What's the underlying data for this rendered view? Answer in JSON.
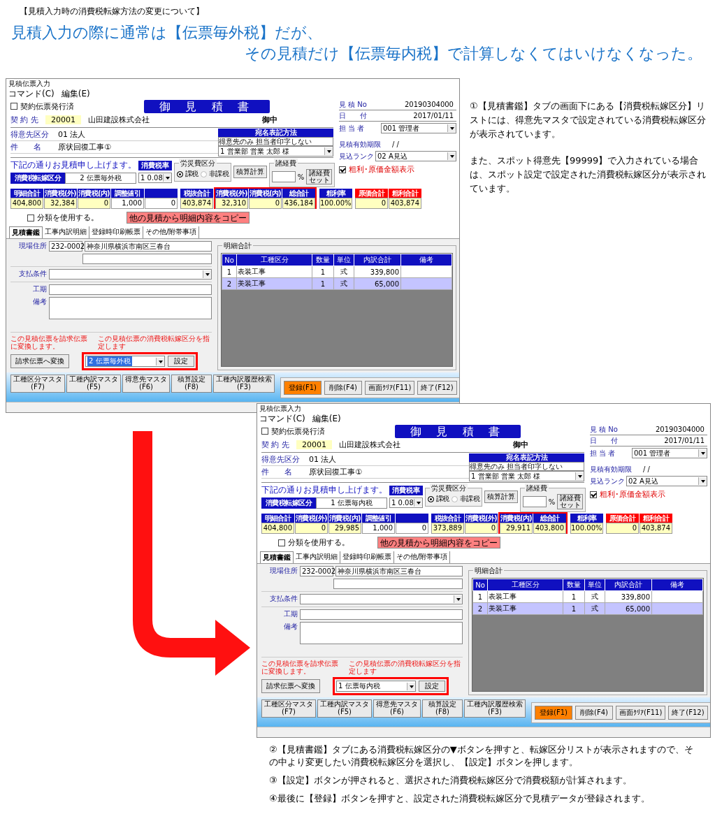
{
  "page_heading": "【見積入力時の消費税転嫁方法の変更について】",
  "headline": [
    "見積入力の際に通常は【伝票毎外税】だが、",
    "その見積だけ【伝票毎内税】で計算しなくてはいけなくなった。"
  ],
  "side_notes": [
    "①【見積書鑑】タブの画面下にある【消費税転嫁区分】リストには、得意先マスタで設定されている消費税転嫁区分が表示されています。",
    "また、スポット得意先【99999】で入力されている場合は、スポット設定で設定された消費税転嫁区分が表示されています。"
  ],
  "windows": [
    {
      "title": "見積伝票入力",
      "menu": [
        "コマンド(C)",
        "編集(E)"
      ],
      "contract_issued": {
        "label": "契約伝票発行済",
        "checked": false
      },
      "heading": "御 見 積 書",
      "contract": {
        "label": "契 約 先",
        "code": "20001",
        "name": "山田建設株式会社",
        "honorific": "御中"
      },
      "info": [
        {
          "label": "見 積 No",
          "value": "20190304000"
        },
        {
          "label": "日　　付",
          "value": "2017/01/11"
        }
      ],
      "staff": {
        "label": "担 当 者",
        "value": "001 管理者"
      },
      "customer_type": {
        "label": "得意先区分",
        "value": "01  法人"
      },
      "subject": {
        "label": "件　　名",
        "value": "原状回復工事①"
      },
      "address_method": {
        "header": "宛名表記方法",
        "option": "得意先のみ  担当者印字しない",
        "contact": "1 営業部 営業  太郎 様"
      },
      "validity": {
        "label": "見積有効期限",
        "value": "/ /"
      },
      "rank": {
        "label": "見込ランク",
        "value": "02 A見込"
      },
      "profit_display": {
        "label": "粗利･原価金額表示",
        "checked": true
      },
      "greeting": "下記の通りお見積申し上げます。",
      "tax_transfer": {
        "label": "消費税転嫁区分",
        "value": "2 伝票毎外税"
      },
      "tax_rate": {
        "label": "消費税率",
        "value": "1  0.08"
      },
      "labor": {
        "legend": "労災費区分",
        "options": [
          {
            "label": "課税",
            "selected": true
          },
          {
            "label": "非課税",
            "selected": false
          }
        ]
      },
      "calc_button": "積算計算",
      "expenses": {
        "legend": "諸経費",
        "unit": "%",
        "button": "諸経費セット"
      },
      "totals": [
        {
          "color": "#1010c0",
          "cells": [
            {
              "label": "明細合計",
              "value": "404,800",
              "kind": "display",
              "highlighted": false
            },
            {
              "label": "消費税(外)",
              "value": "32,384",
              "kind": "display",
              "highlighted": false
            },
            {
              "label": "消費税(内)",
              "value": "0",
              "kind": "display",
              "highlighted": false
            },
            {
              "label": "調整値引",
              "value": "1,000",
              "kind": "input",
              "highlighted": false
            },
            {
              "value": "0",
              "kind": "input",
              "highlighted": false
            }
          ]
        },
        {
          "color": "#1010c0",
          "cells": [
            {
              "label": "税抜合計",
              "value": "403,874",
              "kind": "display",
              "highlighted": false
            },
            {
              "label": "消費税(外)",
              "value": "32,310",
              "kind": "display",
              "highlighted": true
            },
            {
              "label": "消費税(内)",
              "value": "0",
              "kind": "display",
              "highlighted": true
            },
            {
              "label": "総合計",
              "value": "436,184",
              "kind": "display",
              "highlighted": true
            }
          ]
        },
        {
          "color": "#1010c0",
          "cells": [
            {
              "label": "粗利率",
              "value": "100.00%",
              "kind": "display",
              "highlighted": false
            }
          ]
        },
        {
          "color": "#ff0000",
          "cells": [
            {
              "label": "原価合計",
              "value": "0",
              "kind": "display",
              "highlighted": false
            },
            {
              "label": "粗利合計",
              "value": "403,874",
              "kind": "display",
              "highlighted": false
            }
          ]
        }
      ],
      "use_category": {
        "label": "分類を使用する。",
        "checked": false
      },
      "copy_button": "他の見積から明細内容をコピー",
      "tabs": [
        {
          "label": "見積書鑑",
          "selected": true
        },
        {
          "label": "工事内訳明細",
          "selected": false
        },
        {
          "label": "登録時印刷帳票",
          "selected": false
        },
        {
          "label": "その他/附帯事項",
          "selected": false
        }
      ],
      "site_address": {
        "label": "現場住所",
        "zip": "232-0002",
        "address": "神奈川県横浜市南区三春台"
      },
      "payment_label": "支払条件",
      "period_label": "工期",
      "notes_label": "備考",
      "convert_note": "この見積伝票を請求伝票に変換します。",
      "tax_note": "この見積伝票の消費税転嫁区分を指定します",
      "convert_button": "請求伝票へ変換",
      "tax_setting": {
        "value": "2 伝票毎外税",
        "text_selected": true,
        "highlighted": true,
        "button": "設定"
      },
      "detail": {
        "legend": "明細合計",
        "columns": [
          "No",
          "工種区分",
          "数量",
          "単位",
          "内訳合計",
          "備考"
        ],
        "rows": [
          {
            "cells": [
              "1",
              "表装工事",
              "1",
              "式",
              "339,800"
            ],
            "selected": false
          },
          {
            "cells": [
              "2",
              "美装工事",
              "1",
              "式",
              "65,000"
            ],
            "selected": true
          }
        ]
      },
      "function_buttons": [
        {
          "label": "工種区分マスタ",
          "key": "(F7)"
        },
        {
          "label": "工種内訳マスタ",
          "key": "(F5)"
        },
        {
          "label": "得意先マスタ",
          "key": "(F6)"
        },
        {
          "label": "積算設定",
          "key": "(F8)"
        },
        {
          "label": "工種内訳履歴検索",
          "key": "(F3)"
        }
      ],
      "action_buttons": [
        {
          "label": "登録(F1)",
          "primary": true
        },
        {
          "label": "削除(F4)",
          "primary": false
        },
        {
          "label": "画面ｸﾘｱ(F11)",
          "primary": false
        },
        {
          "label": "終了(F12)",
          "primary": false
        }
      ]
    },
    {
      "title": "見積伝票入力",
      "menu": [
        "コマンド(C)",
        "編集(E)"
      ],
      "contract_issued": {
        "label": "契約伝票発行済",
        "checked": false
      },
      "heading": "御 見 積 書",
      "contract": {
        "label": "契 約 先",
        "code": "20001",
        "name": "山田建設株式会社",
        "honorific": "御中"
      },
      "info": [
        {
          "label": "見 積 No",
          "value": "20190304000"
        },
        {
          "label": "日　　付",
          "value": "2017/01/11"
        }
      ],
      "staff": {
        "label": "担 当 者",
        "value": "001 管理者"
      },
      "customer_type": {
        "label": "得意先区分",
        "value": "01  法人"
      },
      "subject": {
        "label": "件　　名",
        "value": "原状回復工事①"
      },
      "address_method": {
        "header": "宛名表記方法",
        "option": "得意先のみ  担当者印字しない",
        "contact": "1 営業部 営業  太郎 様"
      },
      "validity": {
        "label": "見積有効期限",
        "value": "/ /"
      },
      "rank": {
        "label": "見込ランク",
        "value": "02 A見込"
      },
      "profit_display": {
        "label": "粗利･原価金額表示",
        "checked": true
      },
      "greeting": "下記の通りお見積申し上げます。",
      "tax_transfer": {
        "label": "消費税転嫁区分",
        "value": "1 伝票毎内税"
      },
      "tax_rate": {
        "label": "消費税率",
        "value": "1  0.08"
      },
      "labor": {
        "legend": "労災費区分",
        "options": [
          {
            "label": "課税",
            "selected": true
          },
          {
            "label": "非課税",
            "selected": false
          }
        ]
      },
      "calc_button": "積算計算",
      "expenses": {
        "legend": "諸経費",
        "unit": "%",
        "button": "諸経費セット"
      },
      "totals": [
        {
          "color": "#1010c0",
          "cells": [
            {
              "label": "明細合計",
              "value": "404,800",
              "kind": "display",
              "highlighted": false
            },
            {
              "label": "消費税(外)",
              "value": "0",
              "kind": "display",
              "highlighted": false
            },
            {
              "label": "消費税(内)",
              "value": "29,985",
              "kind": "display",
              "highlighted": false
            },
            {
              "label": "調整値引",
              "value": "1,000",
              "kind": "input",
              "highlighted": false
            },
            {
              "value": "0",
              "kind": "input",
              "highlighted": false
            }
          ]
        },
        {
          "color": "#1010c0",
          "cells": [
            {
              "label": "税抜合計",
              "value": "373,889",
              "kind": "display",
              "highlighted": false
            },
            {
              "label": "消費税(外)",
              "value": "0",
              "kind": "display",
              "highlighted": false
            },
            {
              "label": "消費税(内)",
              "value": "29,911",
              "kind": "display",
              "highlighted": true
            },
            {
              "label": "総合計",
              "value": "403,800",
              "kind": "display",
              "highlighted": true
            }
          ]
        },
        {
          "color": "#1010c0",
          "cells": [
            {
              "label": "粗利率",
              "value": "100.00%",
              "kind": "display",
              "highlighted": false
            }
          ]
        },
        {
          "color": "#ff0000",
          "cells": [
            {
              "label": "原価合計",
              "value": "0",
              "kind": "display",
              "highlighted": false
            },
            {
              "label": "粗利合計",
              "value": "403,874",
              "kind": "display",
              "highlighted": false
            }
          ]
        }
      ],
      "use_category": {
        "label": "分類を使用する。",
        "checked": false
      },
      "copy_button": "他の見積から明細内容をコピー",
      "tabs": [
        {
          "label": "見積書鑑",
          "selected": true
        },
        {
          "label": "工事内訳明細",
          "selected": false
        },
        {
          "label": "登録時印刷帳票",
          "selected": false
        },
        {
          "label": "その他/附帯事項",
          "selected": false
        }
      ],
      "site_address": {
        "label": "現場住所",
        "zip": "232-0002",
        "address": "神奈川県横浜市南区三春台"
      },
      "payment_label": "支払条件",
      "period_label": "工期",
      "notes_label": "備考",
      "convert_note": "この見積伝票を請求伝票に変換します。",
      "tax_note": "この見積伝票の消費税転嫁区分を指定します",
      "convert_button": "請求伝票へ変換",
      "tax_setting": {
        "value": "1 伝票毎内税",
        "text_selected": false,
        "highlighted": true,
        "button": "設定"
      },
      "detail": {
        "legend": "明細合計",
        "columns": [
          "No",
          "工種区分",
          "数量",
          "単位",
          "内訳合計",
          "備考"
        ],
        "rows": [
          {
            "cells": [
              "1",
              "表装工事",
              "1",
              "式",
              "339,800"
            ],
            "selected": false
          },
          {
            "cells": [
              "2",
              "美装工事",
              "1",
              "式",
              "65,000"
            ],
            "selected": true
          }
        ]
      },
      "function_buttons": [
        {
          "label": "工種区分マスタ",
          "key": "(F7)"
        },
        {
          "label": "工種内訳マスタ",
          "key": "(F5)"
        },
        {
          "label": "得意先マスタ",
          "key": "(F6)"
        },
        {
          "label": "積算設定",
          "key": "(F8)"
        },
        {
          "label": "工種内訳履歴検索",
          "key": "(F3)"
        }
      ],
      "action_buttons": [
        {
          "label": "登録(F1)",
          "primary": true
        },
        {
          "label": "削除(F4)",
          "primary": false
        },
        {
          "label": "画面ｸﾘｱ(F11)",
          "primary": false
        },
        {
          "label": "終了(F12)",
          "primary": false
        }
      ]
    }
  ],
  "bottom_notes": [
    "②【見積書鑑】タブにある消費税転嫁区分の▼ボタンを押すと、転嫁区分リストが表示されますので、その中より変更したい消費税転嫁区分を選択し、【設定】ボタンを押します。",
    "③【設定】ボタンが押されると、選択された消費税転嫁区分で消費税額が計算されます。",
    "④最後に【登録】ボタンを押すと、設定された消費税転嫁区分で見積データが登録されます。"
  ]
}
